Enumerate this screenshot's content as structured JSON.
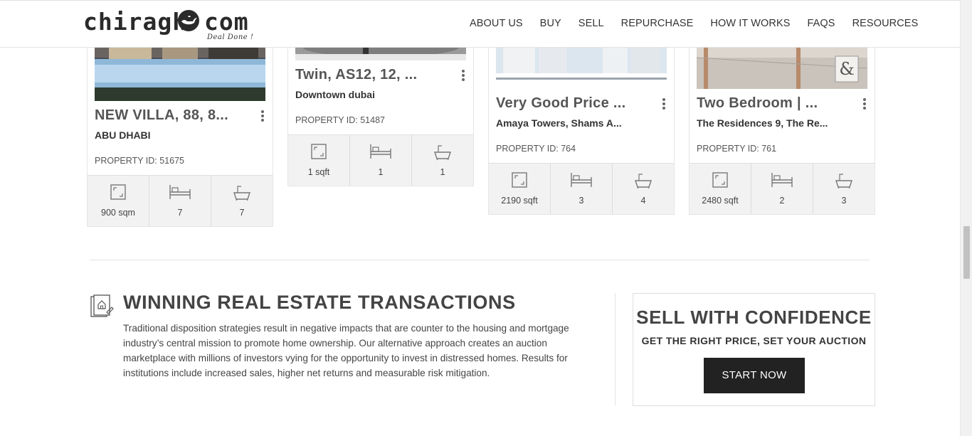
{
  "header": {
    "logo_left": "chiragh",
    "logo_right": "com",
    "logo_tagline": "Deal Done !",
    "nav": [
      "ABOUT US",
      "BUY",
      "SELL",
      "REPURCHASE",
      "HOW IT WORKS",
      "FAQS",
      "RESOURCES"
    ]
  },
  "cards": [
    {
      "title": "NEW VILLA, 88, 8...",
      "location": "ABU DHABI",
      "property_id": "PROPERTY ID: 51675",
      "area": "900 sqm",
      "beds": "7",
      "baths": "7"
    },
    {
      "title": "Twin, AS12, 12, ...",
      "location": "Downtown dubai",
      "property_id": "PROPERTY ID: 51487",
      "area": "1 sqft",
      "beds": "1",
      "baths": "1"
    },
    {
      "title": "Very Good Price ...",
      "location": "Amaya Towers, Shams A...",
      "property_id": "PROPERTY ID: 764",
      "area": "2190 sqft",
      "beds": "3",
      "baths": "4"
    },
    {
      "title": "Two Bedroom | ...",
      "location": "The Residences 9, The Re...",
      "property_id": "PROPERTY ID: 761",
      "area": "2480 sqft",
      "beds": "2",
      "baths": "3"
    }
  ],
  "winning": {
    "title": "WINNING REAL ESTATE TRANSACTIONS",
    "body": "Traditional disposition strategies result in negative impacts that are counter to the housing and mortgage industry’s central mission to promote home ownership. Our alternative approach creates an auction marketplace with millions of investors vying for the opportunity to invest in distressed homes. Results for institutions include increased sales, higher net returns and measurable risk mitigation."
  },
  "sell": {
    "title": "SELL WITH CONFIDENCE",
    "subtitle": "GET THE RIGHT PRICE, SET YOUR AUCTION",
    "button": "START NOW"
  },
  "icons": {
    "area": "floor-area-icon",
    "beds": "bed-icon",
    "baths": "bathtub-icon",
    "winning": "house-document-icon",
    "menu": "kebab-menu-icon"
  }
}
